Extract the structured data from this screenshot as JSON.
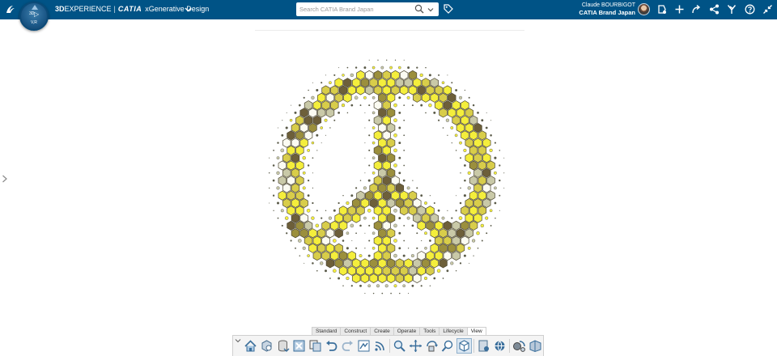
{
  "topbar": {
    "brand_bold": "3D",
    "brand_rest": "EXPERIENCE",
    "brand_separator": "|",
    "brand_product": "CATIA",
    "app_name": "xGenerative Design",
    "compass": {
      "top": "3D",
      "play": "▷",
      "bottom": "V,R"
    },
    "search": {
      "placeholder": "Search CATIA Brand Japan",
      "value": ""
    },
    "user": {
      "name": "Claude BOURBIGOT",
      "tenant": "CATIA Brand Japan"
    },
    "icons": [
      "ds-logo-icon",
      "chevron-down-icon",
      "search-icon",
      "tag-icon",
      "avatar",
      "cube-dot-icon",
      "plus-icon",
      "share-arrow-icon",
      "network-share-icon",
      "compass-y-icon",
      "help-icon",
      "collapse-icon"
    ],
    "colors": {
      "bar": "#005386",
      "text": "#ffffff"
    }
  },
  "action_bar": {
    "tabs": [
      {
        "label": "Standard",
        "active": false
      },
      {
        "label": "Construct",
        "active": false
      },
      {
        "label": "Create",
        "active": false
      },
      {
        "label": "Operate",
        "active": false
      },
      {
        "label": "Tools",
        "active": false
      },
      {
        "label": "Lifecycle",
        "active": false
      },
      {
        "label": "View",
        "active": true
      }
    ],
    "buttons": [
      "home-view-icon",
      "fit-all-icon",
      "save-database-icon",
      "select-icon",
      "copy-icon",
      "undo-icon",
      "redo-icon",
      "update-icon",
      "rss-feed-icon",
      "zoom-icon",
      "pan-icon",
      "rotate-icon",
      "zoom-area-icon",
      "view-cube-icon",
      "properties-icon",
      "network-icon",
      "render-icon",
      "library-icon"
    ]
  },
  "canvas": {
    "model_colors": {
      "bright": "#f4ee3c",
      "mid": "#d8cd4a",
      "olive": "#9b8f3d",
      "dark": "#6d5f3a",
      "white": "#fbfbf2",
      "grey": "#c9c9a8",
      "dot": "#5b5b4a"
    }
  }
}
